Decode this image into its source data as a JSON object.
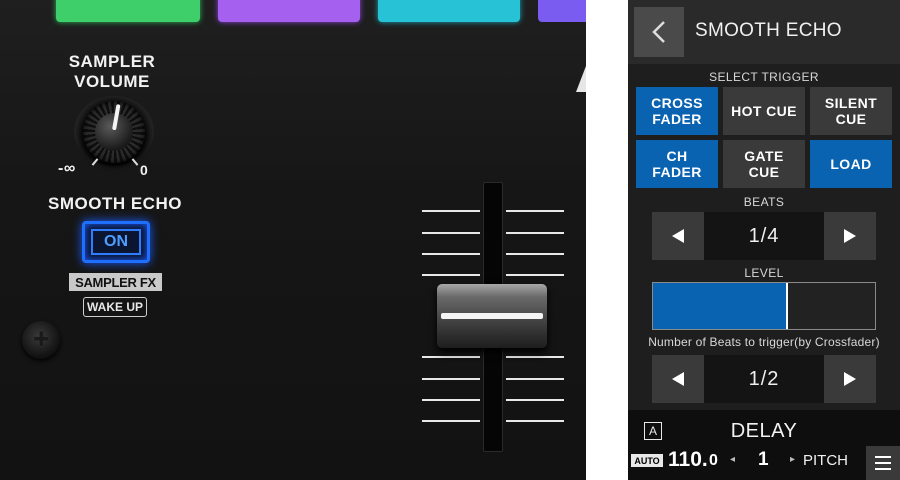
{
  "hardware": {
    "sampler_volume_label": "SAMPLER\nVOLUME",
    "knob_min_label": "-∞",
    "knob_max_label": "0",
    "smooth_echo_label": "SMOOTH ECHO",
    "on_button_label": "ON",
    "sampler_fx_label": "SAMPLER FX",
    "wake_up_label": "WAKE UP",
    "on_button_color": "#1f6fff",
    "pad_colors": [
      "#3ecf6a",
      "#a560f0",
      "#27c2d6",
      "#7a5cf0"
    ]
  },
  "screen": {
    "title": "SMOOTH ECHO",
    "back_icon": "chevron-left-icon",
    "select_trigger_label": "SELECT TRIGGER",
    "trigger_buttons": [
      {
        "label": "CROSS\nFADER",
        "active": true
      },
      {
        "label": "HOT CUE",
        "active": false
      },
      {
        "label": "SILENT\nCUE",
        "active": false
      },
      {
        "label": "CH\nFADER",
        "active": true
      },
      {
        "label": "GATE\nCUE",
        "active": false
      },
      {
        "label": "LOAD",
        "active": true
      }
    ],
    "beats_label": "BEATS",
    "beats_value": "1/4",
    "level_label": "LEVEL",
    "level_fraction": 0.61,
    "xfader_beats_label": "Number of Beats to trigger(by Crossfader)",
    "xfader_beats_value": "1/2",
    "accent_color": "#0a63b0",
    "footer": {
      "deck": "A",
      "fx_name": "DELAY",
      "auto_label": "AUTO",
      "bpm_integer": "110.",
      "bpm_decimal": "0",
      "left_arrow": "◂",
      "beat_value": "1",
      "right_arrow": "▸",
      "pitch_label": "PITCH"
    }
  }
}
